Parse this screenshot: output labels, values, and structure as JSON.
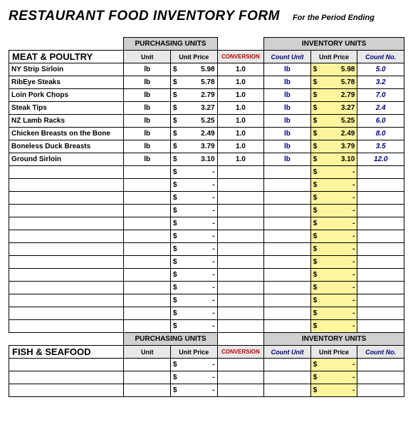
{
  "title": "RESTAURANT FOOD INVENTORY FORM",
  "period_label": "For the Period Ending",
  "group_headers": {
    "purchasing": "PURCHASING UNITS",
    "inventory": "INVENTORY UNITS"
  },
  "col_headers": {
    "unit": "Unit",
    "unit_price": "Unit Price",
    "conversion": "CONVERSION",
    "count_unit": "Count Unit",
    "count_price": "Unit Price",
    "count_no": "Count No."
  },
  "sections": [
    {
      "name": "MEAT & POULTRY",
      "rows": [
        {
          "name": "NY Strip Sirloin",
          "unit": "lb",
          "price": "5.98",
          "conv": "1.0",
          "cunit": "lb",
          "cprice": "5.98",
          "cnum": "5.0"
        },
        {
          "name": "RibEye Steaks",
          "unit": "lb",
          "price": "5.78",
          "conv": "1.0",
          "cunit": "lb",
          "cprice": "5.78",
          "cnum": "3.2"
        },
        {
          "name": "Loin Pork Chops",
          "unit": "lb",
          "price": "2.79",
          "conv": "1.0",
          "cunit": "lb",
          "cprice": "2.79",
          "cnum": "7.0"
        },
        {
          "name": "Steak Tips",
          "unit": "lb",
          "price": "3.27",
          "conv": "1.0",
          "cunit": "lb",
          "cprice": "3.27",
          "cnum": "2.4"
        },
        {
          "name": "NZ Lamb Racks",
          "unit": "lb",
          "price": "5.25",
          "conv": "1.0",
          "cunit": "lb",
          "cprice": "5.25",
          "cnum": "6.0"
        },
        {
          "name": "Chicken Breasts on the Bone",
          "unit": "lb",
          "price": "2.49",
          "conv": "1.0",
          "cunit": "lb",
          "cprice": "2.49",
          "cnum": "8.0"
        },
        {
          "name": "Boneless Duck Breasts",
          "unit": "lb",
          "price": "3.79",
          "conv": "1.0",
          "cunit": "lb",
          "cprice": "3.79",
          "cnum": "3.5"
        },
        {
          "name": "Ground Sirloin",
          "unit": "lb",
          "price": "3.10",
          "conv": "1.0",
          "cunit": "lb",
          "cprice": "3.10",
          "cnum": "12.0"
        }
      ],
      "empty_rows": 13
    },
    {
      "name": "FISH & SEAFOOD",
      "rows": [],
      "empty_rows": 3
    }
  ],
  "dash": "-",
  "dollar": "$"
}
